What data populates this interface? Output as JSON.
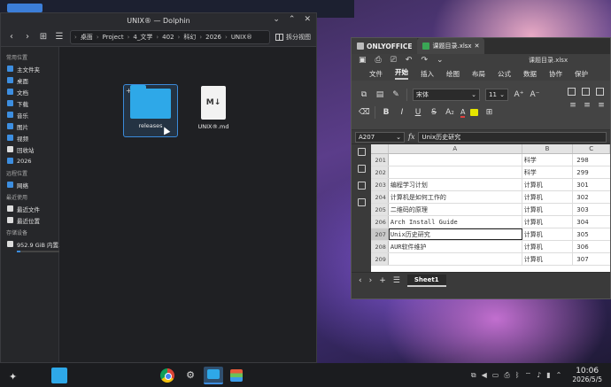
{
  "dolphin": {
    "title": "UNIX® — Dolphin",
    "breadcrumb": [
      "桌面",
      "Project",
      "4_文学",
      "402",
      "科幻",
      "2026",
      "UNIX®"
    ],
    "split_label": "拆分视图",
    "sidebar": {
      "sections": [
        {
          "label": "常用位置",
          "items": [
            "主文件夹",
            "桌面",
            "文档",
            "下载",
            "音乐",
            "图片",
            "视频",
            "回收站",
            "2026"
          ]
        },
        {
          "label": "远程位置",
          "items": [
            "网络"
          ]
        },
        {
          "label": "最近使用",
          "items": [
            "最近文件",
            "最近位置"
          ]
        },
        {
          "label": "存储设备",
          "items": [
            "952.9 GiB 内置..."
          ]
        }
      ]
    },
    "files": [
      {
        "name": "releases",
        "icon": "folder-icon"
      },
      {
        "name": "UNIX®.md",
        "icon": "markdown-file-icon"
      }
    ]
  },
  "onlyoffice": {
    "brand": "ONLYOFFICE",
    "file_tab": "课题目录.xlsx",
    "doc_title": "课题目录.xlsx",
    "menu": [
      "文件",
      "开始",
      "插入",
      "绘图",
      "布局",
      "公式",
      "数据",
      "协作",
      "保护"
    ],
    "active_menu": "开始",
    "font_name": "宋体",
    "font_size": "11",
    "cell_ref": "A207",
    "formula": "Unix历史研究",
    "columns": [
      "A",
      "B",
      "C"
    ],
    "rows": [
      {
        "num": "201",
        "a": "",
        "b": "科学",
        "c": "298"
      },
      {
        "num": "202",
        "a": "",
        "b": "科学",
        "c": "299"
      },
      {
        "num": "203",
        "a": "编程学习计划",
        "b": "计算机",
        "c": "301"
      },
      {
        "num": "204",
        "a": "计算机是如何工作的",
        "b": "计算机",
        "c": "302"
      },
      {
        "num": "205",
        "a": "二维码的原理",
        "b": "计算机",
        "c": "303"
      },
      {
        "num": "206",
        "a": "Arch Install Guide",
        "b": "计算机",
        "c": "304"
      },
      {
        "num": "207",
        "a": "Unix历史研究",
        "b": "计算机",
        "c": "305"
      },
      {
        "num": "208",
        "a": "AUR软件维护",
        "b": "计算机",
        "c": "306"
      },
      {
        "num": "209",
        "a": "",
        "b": "计算机",
        "c": "307"
      }
    ],
    "sheet_tab": "Sheet1"
  },
  "taskbar": {
    "time": "10:06",
    "date": "2026/5/5"
  }
}
